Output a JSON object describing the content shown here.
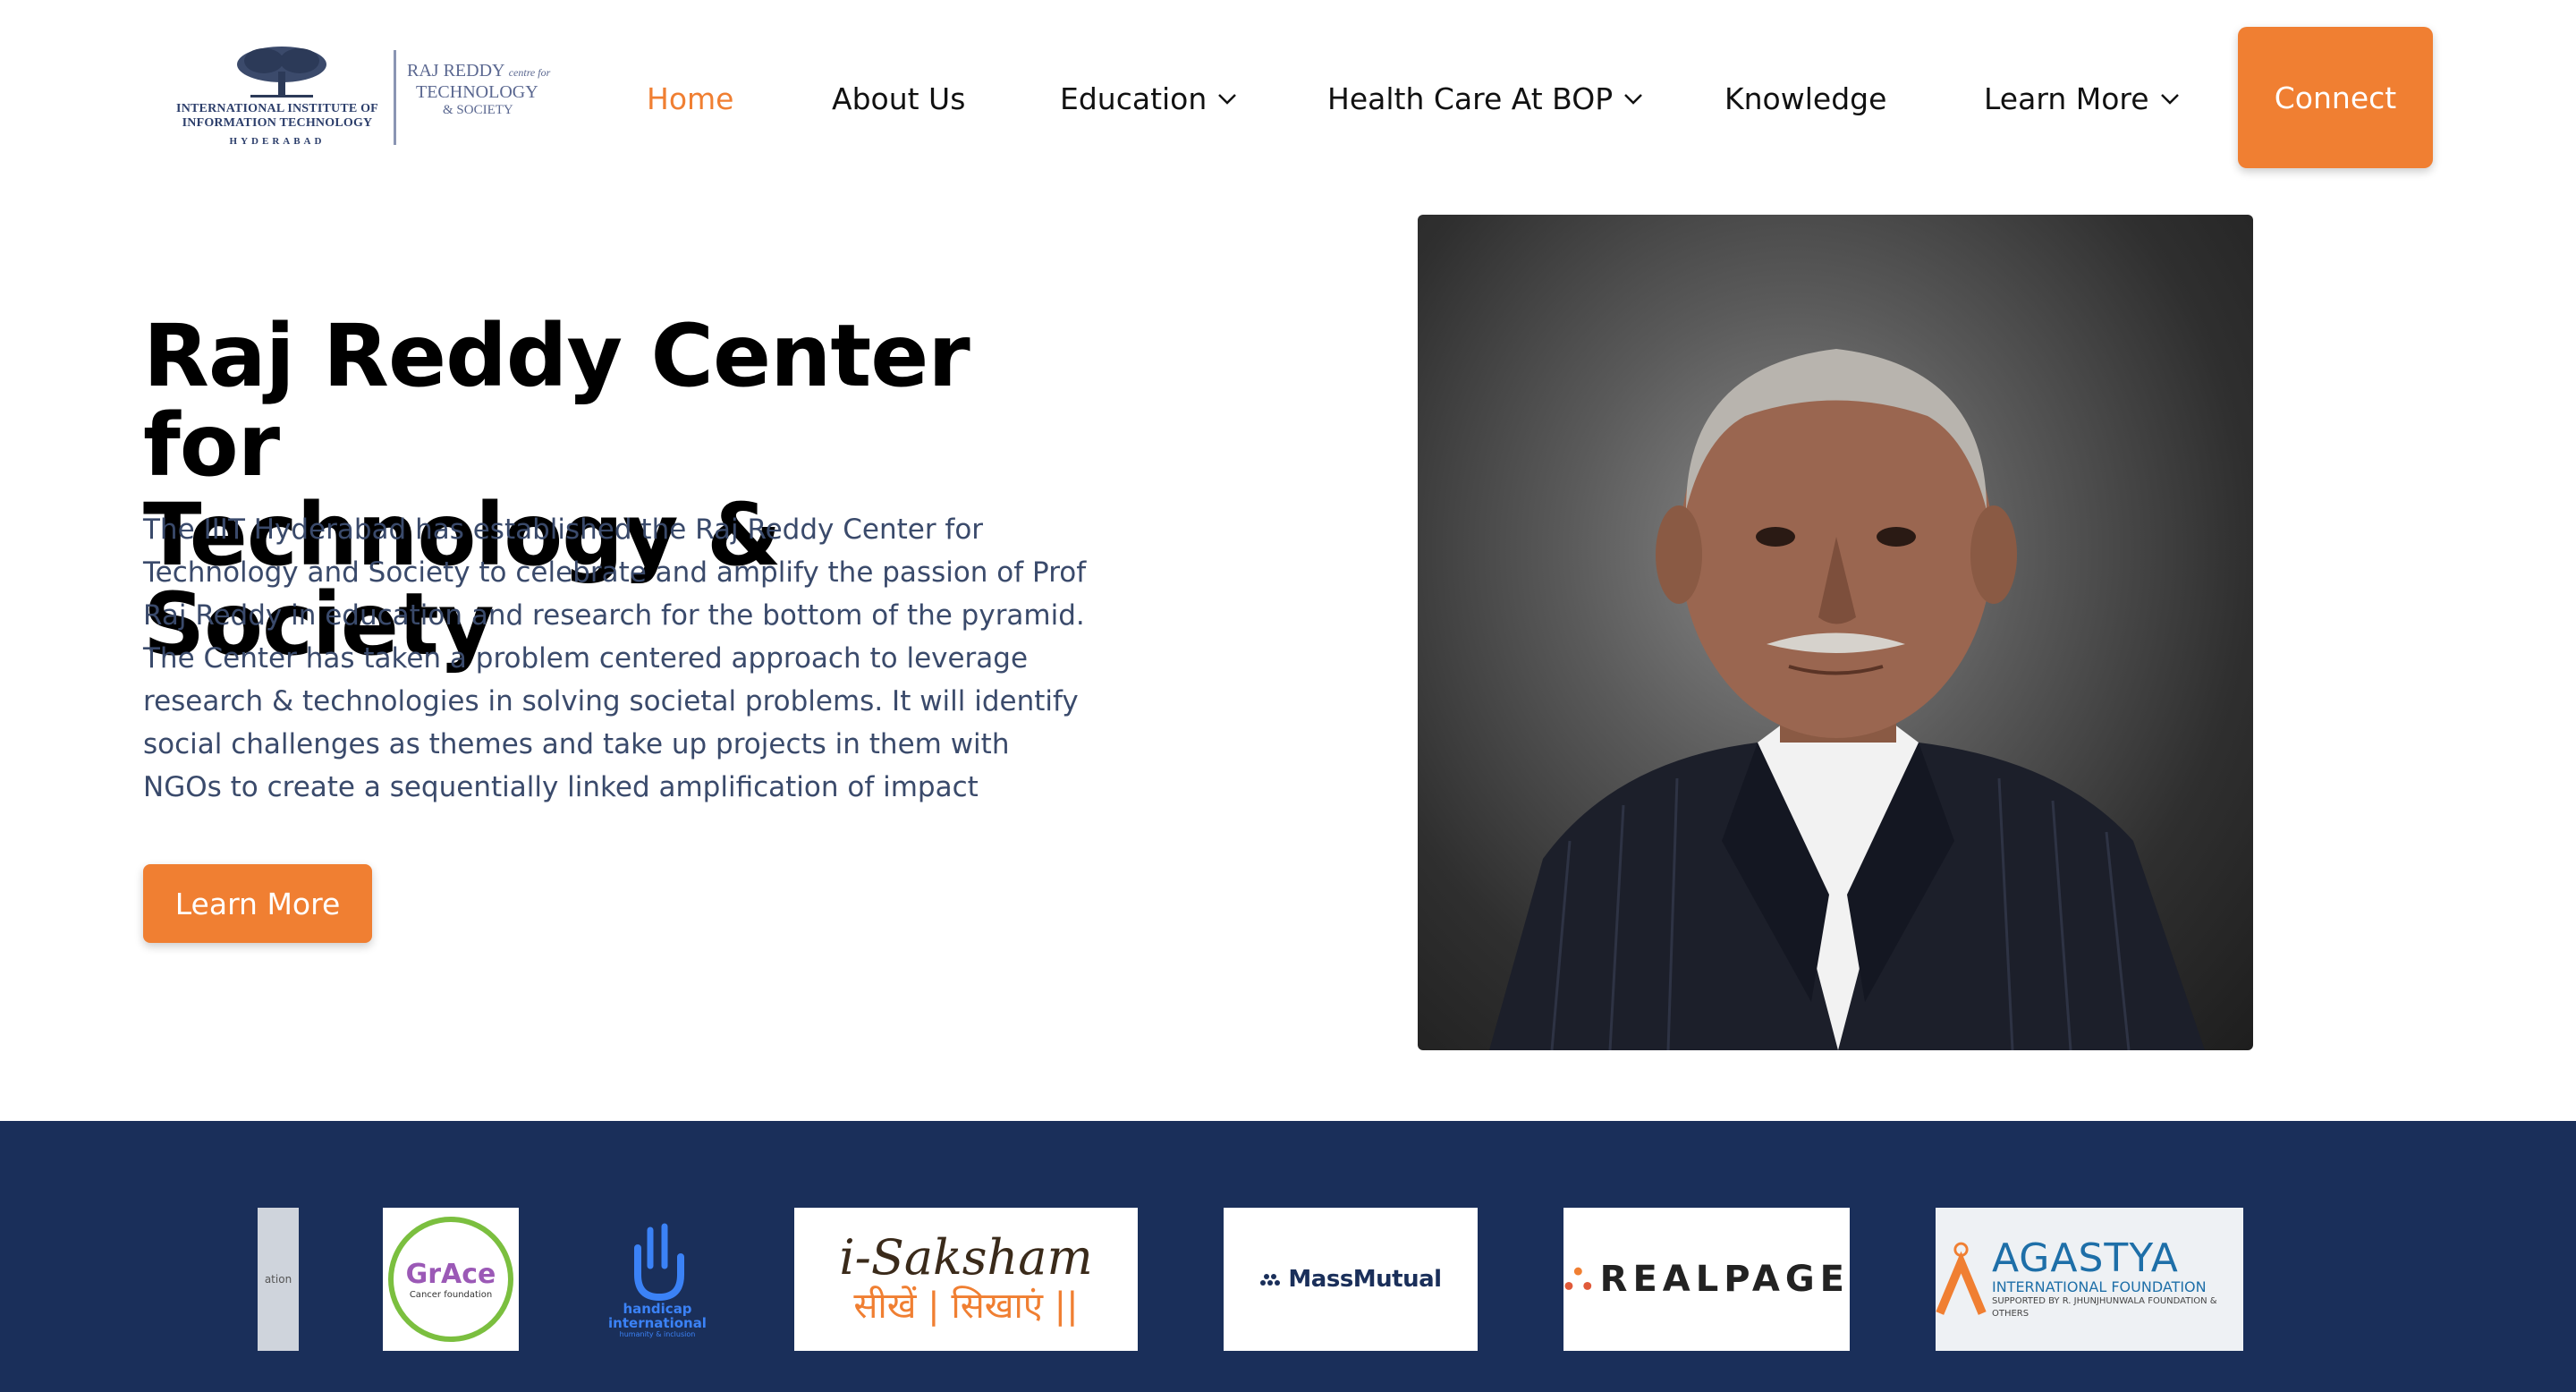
{
  "header": {
    "logo": {
      "iiit_line1": "INTERNATIONAL INSTITUTE OF",
      "iiit_line2": "INFORMATION TECHNOLOGY",
      "iiit_line3": "HYDERABAD",
      "rr_line1": "RAJ REDDY",
      "rr_line1_small": "centre for",
      "rr_line2": "TECHNOLOGY",
      "rr_line3": "& SOCIETY"
    },
    "nav": [
      {
        "label": "Home",
        "active": true
      },
      {
        "label": "About Us"
      },
      {
        "label": "Education",
        "dropdown": true
      },
      {
        "label": "Health Care At BOP",
        "dropdown": true
      },
      {
        "label": "Knowledge"
      },
      {
        "label": "Learn More",
        "dropdown": true
      }
    ],
    "connect_label": "Connect"
  },
  "hero": {
    "title_line1": "Raj Reddy Center for",
    "title_line2": "Technology & Society",
    "body": "The IIIT Hyderabad has established the Raj Reddy Center for Technology and Society to celebrate and amplify the passion of Prof Raj Reddy in education and research for the bottom of the pyramid. The Center has taken a problem centered approach to leverage research & technologies in solving societal problems. It will identify social challenges as themes and take up projects in them with NGOs to create a sequentially linked amplification of impact",
    "button_label": "Learn More"
  },
  "partners": {
    "cut_text": "ation",
    "grace_name": "GrAce",
    "grace_sub": "Cancer foundation",
    "handicap_name": "handicap international",
    "handicap_sub": "humanity & inclusion",
    "saksham_top": "i-Saksham",
    "saksham_bottom": "सीखें | सिखाएं ||",
    "massmutual": "MassMutual",
    "realpage": "REALPAGE",
    "agastya_name": "AGASTYA",
    "agastya_sub": "INTERNATIONAL FOUNDATION",
    "agastya_supported": "SUPPORTED BY R. JHUNJHUNWALA FOUNDATION & OTHERS"
  },
  "colors": {
    "accent": "#f07f32",
    "partner_band": "#1a2f5a",
    "body_text": "#3a4a6b"
  }
}
